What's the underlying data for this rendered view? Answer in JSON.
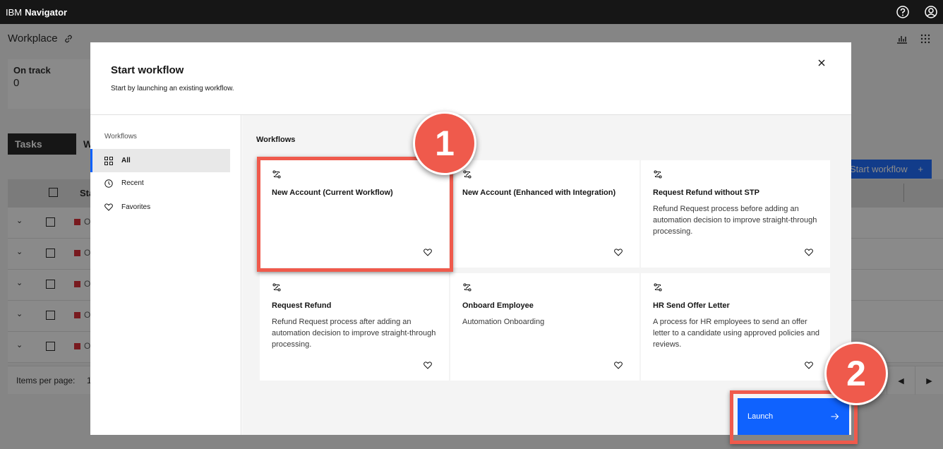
{
  "topbar": {
    "brand_prefix": "IBM",
    "brand_name": "Navigator",
    "help_icon": "help-icon",
    "user_icon": "user-avatar-icon"
  },
  "background": {
    "title": "Workplace",
    "on_track": {
      "label": "On track",
      "value": "0"
    },
    "tabs": [
      {
        "label": "Tasks"
      },
      {
        "label": "W"
      }
    ],
    "start_workflow_label": "Start workflow",
    "status_header": "Sta",
    "rows": [
      {
        "status": "Ov"
      },
      {
        "status": "Ov"
      },
      {
        "status": "Ov"
      },
      {
        "status": "Ov"
      },
      {
        "status": "Ov"
      }
    ],
    "items_per_page_label": "Items per page:",
    "items_per_page_value": "1"
  },
  "modal": {
    "title": "Start workflow",
    "subtitle": "Start by launching an existing workflow.",
    "sidebar": {
      "label": "Workflows",
      "items": [
        {
          "label": "All",
          "icon": "grid-icon",
          "active": true
        },
        {
          "label": "Recent",
          "icon": "clock-icon",
          "active": false
        },
        {
          "label": "Favorites",
          "icon": "heart-icon",
          "active": false
        }
      ]
    },
    "section_label": "Workflows",
    "cards": [
      {
        "title": "New Account (Current Workflow)",
        "description": ""
      },
      {
        "title": "New Account (Enhanced with Integration)",
        "description": ""
      },
      {
        "title": "Request Refund without STP",
        "description": "Refund Request process before adding an automation decision to improve straight-through processing."
      },
      {
        "title": "Request Refund",
        "description": "Refund Request process after adding an automation decision to improve straight-through processing."
      },
      {
        "title": "Onboard Employee",
        "description": "Automation Onboarding"
      },
      {
        "title": "HR Send Offer Letter",
        "description": "A process for HR employees to send an offer letter to a candidate using approved policies and reviews."
      }
    ],
    "launch_label": "Launch"
  },
  "annotations": {
    "step1": "1",
    "step2": "2",
    "accent_color": "#ef5a4c"
  },
  "colors": {
    "primary": "#0f62fe",
    "topbar": "#161616",
    "status_overdue": "#da1e28"
  }
}
